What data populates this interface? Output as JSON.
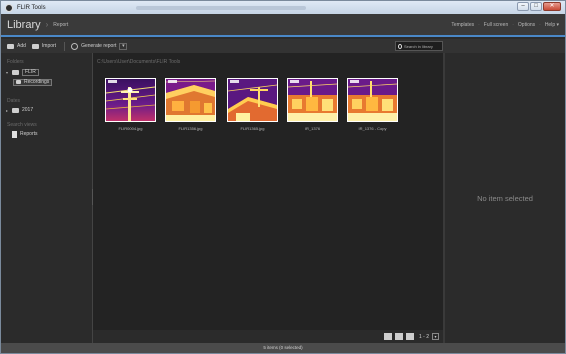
{
  "window": {
    "title": "FLIR Tools"
  },
  "header": {
    "title": "Library",
    "subtitle": "Report",
    "links": [
      "Templates",
      "Full screen",
      "Options",
      "Help ▾"
    ]
  },
  "toolbar": {
    "add_label": "Add",
    "import_label": "Import",
    "generate_label": "Generate report",
    "search_placeholder": "Search in library"
  },
  "sidebar": {
    "folders_heading": "Folders",
    "root_folder": "FLIR",
    "sub_folder": "Recordings",
    "dates_heading": "Dates",
    "year": "2017",
    "search_views_heading": "Search views",
    "reports_label": "Reports"
  },
  "content": {
    "path": "C:\\Users\\User\\Documents\\FLIR Tools",
    "thumbnails": [
      {
        "caption": "FLIR0004.jpg"
      },
      {
        "caption": "FLIR1356.jpg"
      },
      {
        "caption": "FLIR1365.jpg"
      },
      {
        "caption": "IR_1376"
      },
      {
        "caption": "IR_1376 - Copy"
      }
    ]
  },
  "right_panel": {
    "empty_text": "No item selected"
  },
  "viewbar": {
    "zoom": "1 - 2"
  },
  "status": {
    "text": "5 items (0 selected)"
  },
  "colors": {
    "accent": "#4a88c8",
    "background": "#232323",
    "panel": "#2b2b2b"
  }
}
